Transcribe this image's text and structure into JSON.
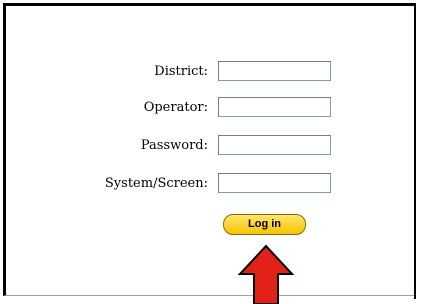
{
  "form": {
    "fields": [
      {
        "label": "District:",
        "value": ""
      },
      {
        "label": "Operator:",
        "value": ""
      },
      {
        "label": "Password:",
        "value": ""
      },
      {
        "label": "System/Screen:",
        "value": ""
      }
    ],
    "login_label": "Log in"
  },
  "annotation": {
    "arrow_icon": "up-arrow-icon",
    "arrow_color": "#e32119",
    "arrow_outline": "#000000"
  },
  "colors": {
    "button_fill": "#f6c400",
    "field_border": "#7f9db9"
  }
}
